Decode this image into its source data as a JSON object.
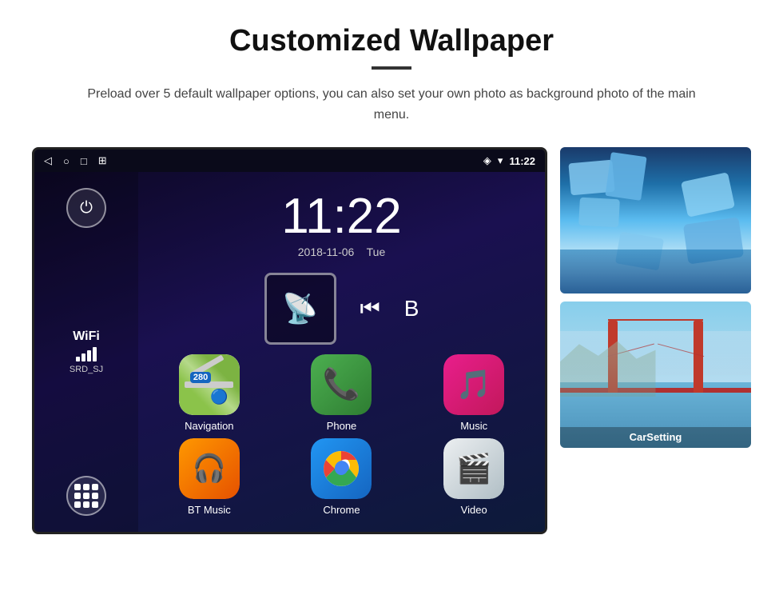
{
  "page": {
    "title": "Customized Wallpaper",
    "description": "Preload over 5 default wallpaper options, you can also set your own photo as background photo of the main menu."
  },
  "device": {
    "statusBar": {
      "time": "11:22",
      "icons": [
        "back-icon",
        "home-icon",
        "recents-icon",
        "screenshot-icon"
      ],
      "rightIcons": [
        "location-icon",
        "wifi-icon"
      ]
    },
    "clock": {
      "time": "11:22",
      "date": "2018-11-06",
      "day": "Tue"
    },
    "wifi": {
      "label": "WiFi",
      "ssid": "SRD_SJ"
    },
    "apps": [
      {
        "id": "navigation",
        "label": "Navigation",
        "icon": "map-icon"
      },
      {
        "id": "phone",
        "label": "Phone",
        "icon": "phone-icon"
      },
      {
        "id": "music",
        "label": "Music",
        "icon": "music-icon"
      },
      {
        "id": "bt-music",
        "label": "BT Music",
        "icon": "bluetooth-icon"
      },
      {
        "id": "chrome",
        "label": "Chrome",
        "icon": "chrome-icon"
      },
      {
        "id": "video",
        "label": "Video",
        "icon": "video-icon"
      }
    ],
    "nav_shield_text": "280",
    "nav_label": "Navigation"
  },
  "wallpapers": [
    {
      "id": "wallpaper-1",
      "label": "Ice/Glacier scene"
    },
    {
      "id": "wallpaper-2",
      "label": "CarSetting",
      "sublabel": "Golden Gate Bridge"
    }
  ]
}
